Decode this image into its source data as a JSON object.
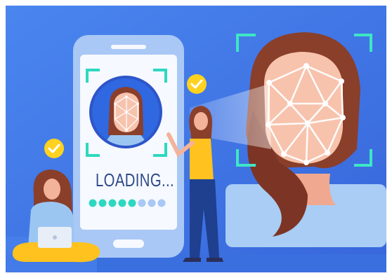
{
  "screen": {
    "status_text": "LOADING...",
    "progress": {
      "total_dots": 8,
      "filled_dots": 5
    }
  },
  "icons": [
    "check-badge-icon",
    "face-scan-frame-icon",
    "face-mesh-icon"
  ],
  "colors": {
    "background": "#3f78e8",
    "phone_body": "#a9c8f5",
    "phone_screen": "#f6f9ff",
    "scan_frame": "#3ee6c5",
    "accent_teal": "#2dd8c0",
    "badge_yellow": "#ffd21f",
    "hair_brown": "#8a3f2a",
    "skin": "#f3b39a",
    "shirt_blue": "#9cc6f2",
    "pants_navy": "#1f3f8f",
    "shirt_yellow": "#ffc21f"
  }
}
